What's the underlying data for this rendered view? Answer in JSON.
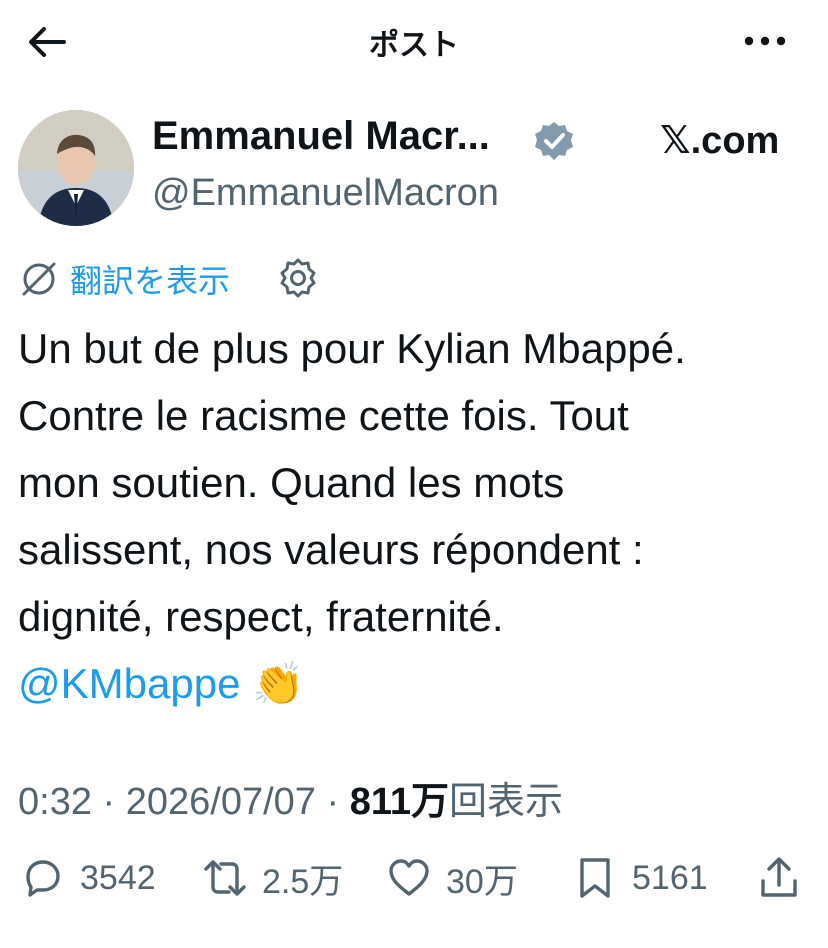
{
  "header": {
    "title": "ポスト",
    "back_icon": "arrow-left-icon",
    "more_icon": "more-icon"
  },
  "author": {
    "name": "Emmanuel Macr...",
    "handle": "@EmmanuelMacron",
    "verified": true,
    "badge_color": "#829aab",
    "source_brand_mark": "𝕏",
    "source_suffix": ".com"
  },
  "translate": {
    "label": "翻訳を表示"
  },
  "tweet": {
    "lines": [
      "Un but de plus pour Kylian Mbappé.",
      "Contre le racisme cette fois. Tout",
      "mon soutien. Quand les mots",
      "salissent, nos valeurs répondent :",
      "dignité, respect, fraternité."
    ],
    "mention": "@KMbappe",
    "emoji": "👏"
  },
  "meta": {
    "time": "0:32",
    "separator": "·",
    "date": "2026/07/07",
    "views_count": "811万",
    "views_label": "回表示"
  },
  "actions": {
    "replies": "3542",
    "reposts": "2.5万",
    "likes": "30万",
    "bookmarks": "5161"
  },
  "colors": {
    "link": "#1d9bf0",
    "text": "#0f1419",
    "secondary": "#536471"
  }
}
